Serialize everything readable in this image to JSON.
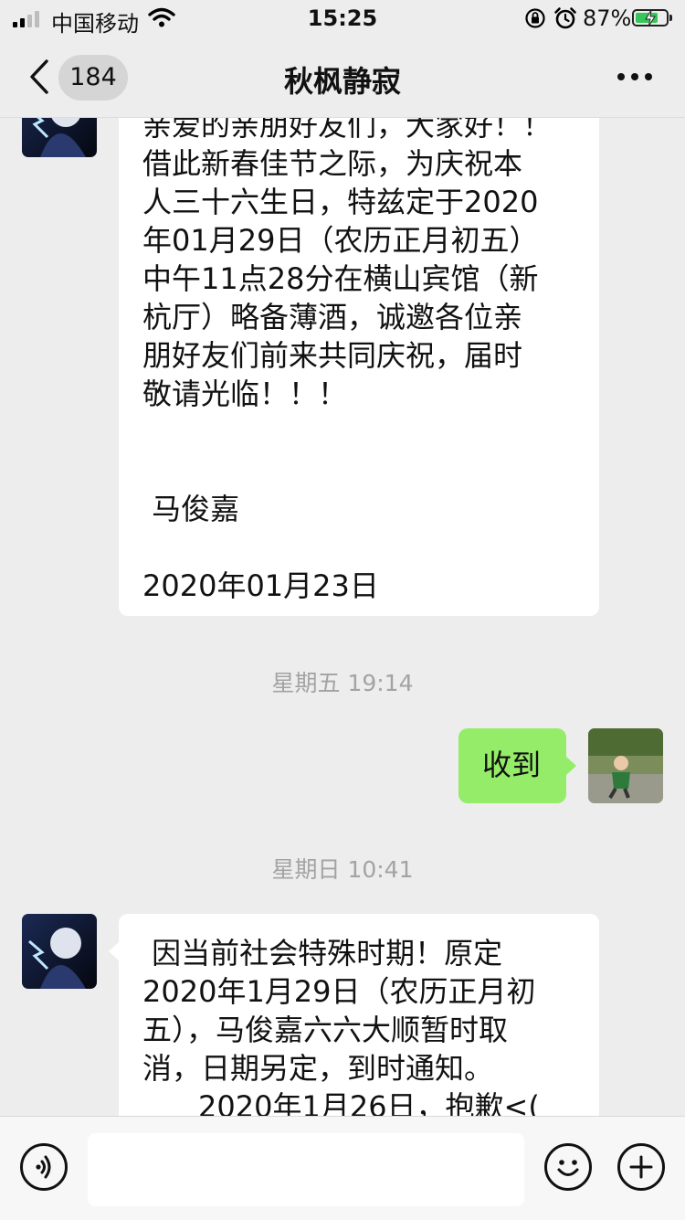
{
  "status_bar": {
    "carrier": "中国移动",
    "time": "15:25",
    "battery_percent": "87%",
    "signal_bars_active": 2,
    "battery_level": 0.87,
    "battery_color": "#35c759"
  },
  "nav": {
    "unread_count": "184",
    "title": "秋枫静寂",
    "back_icon": "chevron-left-icon",
    "more_icon": "more-icon"
  },
  "messages": [
    {
      "sender": "other",
      "text": "亲爱的亲朋好友们，大家好！！\n借此新春佳节之际，为庆祝本\n人三十六生日，特兹定于2020\n年01月29日（农历正月初五）\n中午11点28分在横山宾馆（新\n杭厅）略备薄酒，诚邀各位亲\n朋好友们前来共同庆祝，届时\n敬请光临！！！\n\n\n 马俊嘉\n\n2020年01月23日"
    },
    {
      "type": "timestamp",
      "text": "星期五 19:14"
    },
    {
      "sender": "me",
      "text": "收到"
    },
    {
      "type": "timestamp",
      "text": "星期日 10:41"
    },
    {
      "sender": "other",
      "text": " 因当前社会特殊时期！原定\n2020年1月29日（农历正月初\n五），马俊嘉六六大顺暂时取\n消，日期另定，到时通知。\n      2020年1月26日，抱歉<("
    }
  ],
  "input_bar": {
    "voice_icon": "voice-icon",
    "emoji_icon": "emoji-icon",
    "plus_icon": "plus-icon"
  },
  "colors": {
    "background": "#ededed",
    "sent_bubble": "#95ec69",
    "received_bubble": "#ffffff",
    "timestamp_text": "#a3a3a3"
  }
}
